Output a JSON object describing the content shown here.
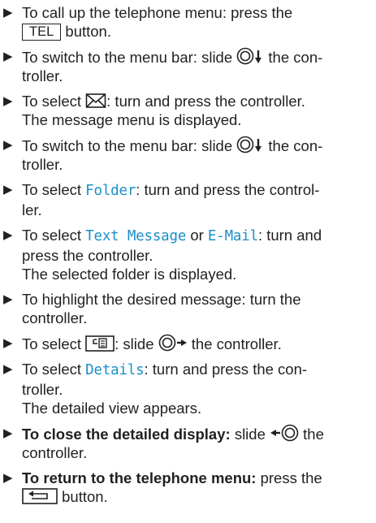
{
  "steps": [
    {
      "pre": "To call up the telephone menu: press the",
      "key": "TEL",
      "post": "button."
    },
    {
      "pre": "To switch to the menu bar: slide",
      "post1": "the con-",
      "post2": "troller."
    },
    {
      "pre": "To select",
      "post": ": turn and press the controller.",
      "result": "The message menu is displayed."
    },
    {
      "pre": "To switch to the menu bar: slide",
      "post1": "the con-",
      "post2": "troller."
    },
    {
      "pre": "To select",
      "item": "Folder",
      "post1": ": turn and press the control-",
      "post2": "ler."
    },
    {
      "pre": "To select",
      "item1": "Text Message",
      "or": "or",
      "item2": "E-Mail",
      "post1": ": turn and",
      "post2": "press the controller.",
      "result": "The selected folder is displayed."
    },
    {
      "line1": "To highlight the desired message: turn the",
      "line2": "controller."
    },
    {
      "pre": "To select",
      "mid": ": slide",
      "post": "the controller."
    },
    {
      "pre": "To select",
      "item": "Details",
      "post1": ": turn and press the con-",
      "post2": "troller.",
      "result": "The detailed view appears."
    },
    {
      "bold": "To close the detailed display:",
      "pre": "slide",
      "post1": "the",
      "post2": "controller."
    },
    {
      "bold": "To return to the telephone menu:",
      "post1": "press the",
      "post2": "button."
    }
  ],
  "bullet": "▶",
  "icons": [
    "tel-key",
    "controller-slide-down",
    "envelope-icon",
    "menu-list-key",
    "controller-slide-right",
    "controller-slide-left",
    "back-key"
  ],
  "accent_color": "#1b8fc8"
}
